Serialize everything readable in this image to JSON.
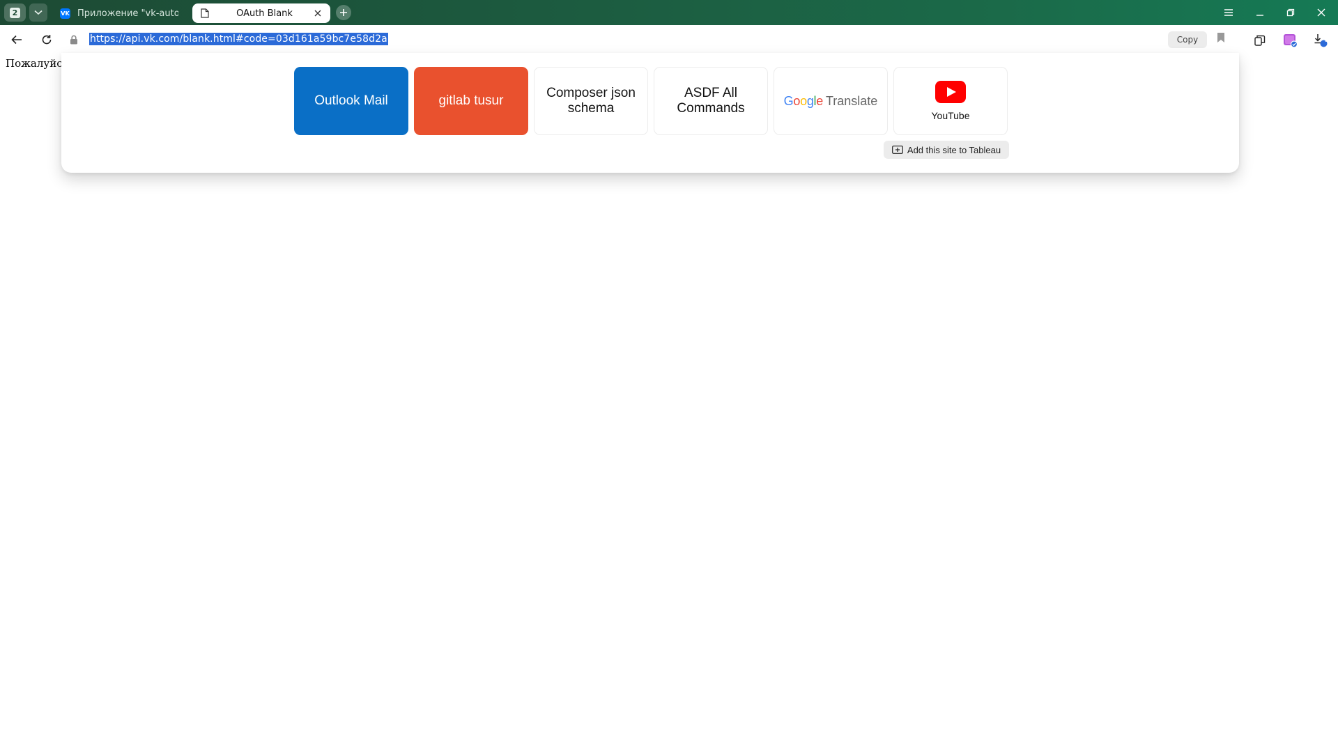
{
  "browser": {
    "tab_count": "2",
    "tabs": [
      {
        "title": "Приложение \"vk-autopos",
        "favicon": "vk-icon"
      },
      {
        "title": "OAuth Blank",
        "favicon": "page-icon"
      }
    ],
    "url": "https://api.vk.com/blank.html#code=03d161a59bc7e58d2a",
    "copy_label": "Copy",
    "downloads_badge": "0"
  },
  "page": {
    "visible_text": "Пожалуйста"
  },
  "tableau": {
    "tiles": [
      {
        "label": "Outlook Mail",
        "color": "#0a6fc6"
      },
      {
        "label": "gitlab tusur",
        "color": "#e9512e"
      },
      {
        "label": "Composer json schema"
      },
      {
        "label": "ASDF All Commands"
      },
      {
        "label": "Translate",
        "logo_text": "Google"
      },
      {
        "label": "YouTube",
        "icon": "youtube-icon"
      }
    ],
    "add_site_label": "Add this site to Tableau"
  },
  "colors": {
    "accent": "#2b6ad8",
    "titlebar": "#1c5a3f"
  }
}
